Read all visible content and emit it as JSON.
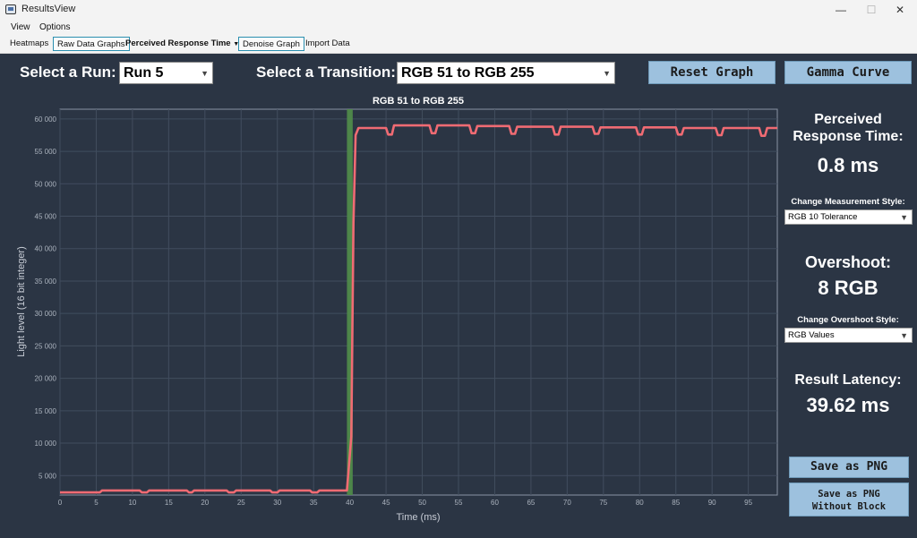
{
  "window": {
    "title": "ResultsView",
    "minimize_glyph": "—",
    "maximize_glyph": "☐",
    "close_glyph": "✕"
  },
  "menu": {
    "view": "View",
    "options": "Options"
  },
  "toolbar": {
    "heatmaps": "Heatmaps",
    "raw_data_graphs": "Raw Data Graphs",
    "perceived_response_time": "Perceived Response Time",
    "denoise_graph": "Denoise Graph",
    "import_data": "Import Data"
  },
  "controls": {
    "select_run_label": "Select a Run:",
    "run_value": "Run 5",
    "select_transition_label": "Select a Transition:",
    "transition_value": "RGB 51 to RGB 255",
    "reset_graph": "Reset Graph",
    "gamma_curve": "Gamma Curve"
  },
  "stats": {
    "perceived_title_1": "Perceived",
    "perceived_title_2": "Response Time:",
    "perceived_value": "0.8 ms",
    "change_measurement_label": "Change Measurement Style:",
    "measurement_style": "RGB 10 Tolerance",
    "overshoot_title": "Overshoot:",
    "overshoot_value": "8 RGB",
    "change_overshoot_label": "Change Overshoot Style:",
    "overshoot_style": "RGB Values",
    "latency_title": "Result Latency:",
    "latency_value": "39.62 ms"
  },
  "actions": {
    "save_png": "Save as PNG",
    "save_png_no_block_1": "Save as PNG",
    "save_png_no_block_2": "Without Block"
  },
  "chart_data": {
    "type": "line",
    "title": "RGB 51 to RGB 255",
    "xlabel": "Time (ms)",
    "ylabel": "Light level (16 bit integer)",
    "xlim": [
      0,
      99
    ],
    "ylim": [
      2000,
      61500
    ],
    "x_ticks": [
      0,
      5,
      10,
      15,
      20,
      25,
      30,
      35,
      40,
      45,
      50,
      55,
      60,
      65,
      70,
      75,
      80,
      85,
      90,
      95
    ],
    "y_ticks": [
      5000,
      10000,
      15000,
      20000,
      25000,
      30000,
      35000,
      40000,
      45000,
      50000,
      55000,
      60000
    ],
    "y_tick_labels": [
      "5 000",
      "10 000",
      "15 000",
      "20 000",
      "25 000",
      "30 000",
      "35 000",
      "40 000",
      "45 000",
      "50 000",
      "55 000",
      "60 000"
    ],
    "grid": true,
    "highlight_band": [
      39.6,
      40.4
    ],
    "series": [
      {
        "color": "#f06b73",
        "points": [
          [
            0,
            2400
          ],
          [
            5.5,
            2400
          ],
          [
            5.8,
            2700
          ],
          [
            11,
            2700
          ],
          [
            11.3,
            2400
          ],
          [
            12,
            2400
          ],
          [
            12.3,
            2700
          ],
          [
            17.5,
            2700
          ],
          [
            17.8,
            2400
          ],
          [
            18.2,
            2400
          ],
          [
            18.5,
            2700
          ],
          [
            23,
            2700
          ],
          [
            23.3,
            2400
          ],
          [
            24,
            2400
          ],
          [
            24.3,
            2700
          ],
          [
            29,
            2700
          ],
          [
            29.3,
            2400
          ],
          [
            30,
            2400
          ],
          [
            30.3,
            2700
          ],
          [
            34.5,
            2700
          ],
          [
            34.8,
            2400
          ],
          [
            35.5,
            2400
          ],
          [
            35.8,
            2700
          ],
          [
            39.6,
            2700
          ],
          [
            40.2,
            11000
          ],
          [
            40.5,
            44000
          ],
          [
            40.8,
            57500
          ],
          [
            41.2,
            58600
          ],
          [
            45,
            58600
          ],
          [
            45.3,
            57600
          ],
          [
            45.8,
            57600
          ],
          [
            46.1,
            59000
          ],
          [
            51,
            59000
          ],
          [
            51.3,
            57800
          ],
          [
            51.8,
            57800
          ],
          [
            52.1,
            59000
          ],
          [
            56.5,
            59000
          ],
          [
            56.8,
            57800
          ],
          [
            57.3,
            57800
          ],
          [
            57.6,
            58900
          ],
          [
            62,
            58900
          ],
          [
            62.3,
            57700
          ],
          [
            62.8,
            57700
          ],
          [
            63.1,
            58800
          ],
          [
            68,
            58800
          ],
          [
            68.3,
            57600
          ],
          [
            68.8,
            57600
          ],
          [
            69.1,
            58800
          ],
          [
            73.5,
            58800
          ],
          [
            73.8,
            57700
          ],
          [
            74.3,
            57700
          ],
          [
            74.6,
            58700
          ],
          [
            79.5,
            58700
          ],
          [
            79.8,
            57600
          ],
          [
            80.3,
            57600
          ],
          [
            80.6,
            58700
          ],
          [
            85,
            58700
          ],
          [
            85.3,
            57600
          ],
          [
            85.8,
            57600
          ],
          [
            86.1,
            58600
          ],
          [
            90.5,
            58600
          ],
          [
            90.8,
            57500
          ],
          [
            91.3,
            57500
          ],
          [
            91.6,
            58600
          ],
          [
            96.5,
            58600
          ],
          [
            96.8,
            57400
          ],
          [
            97.3,
            57400
          ],
          [
            97.6,
            58600
          ],
          [
            99,
            58600
          ]
        ]
      }
    ]
  }
}
